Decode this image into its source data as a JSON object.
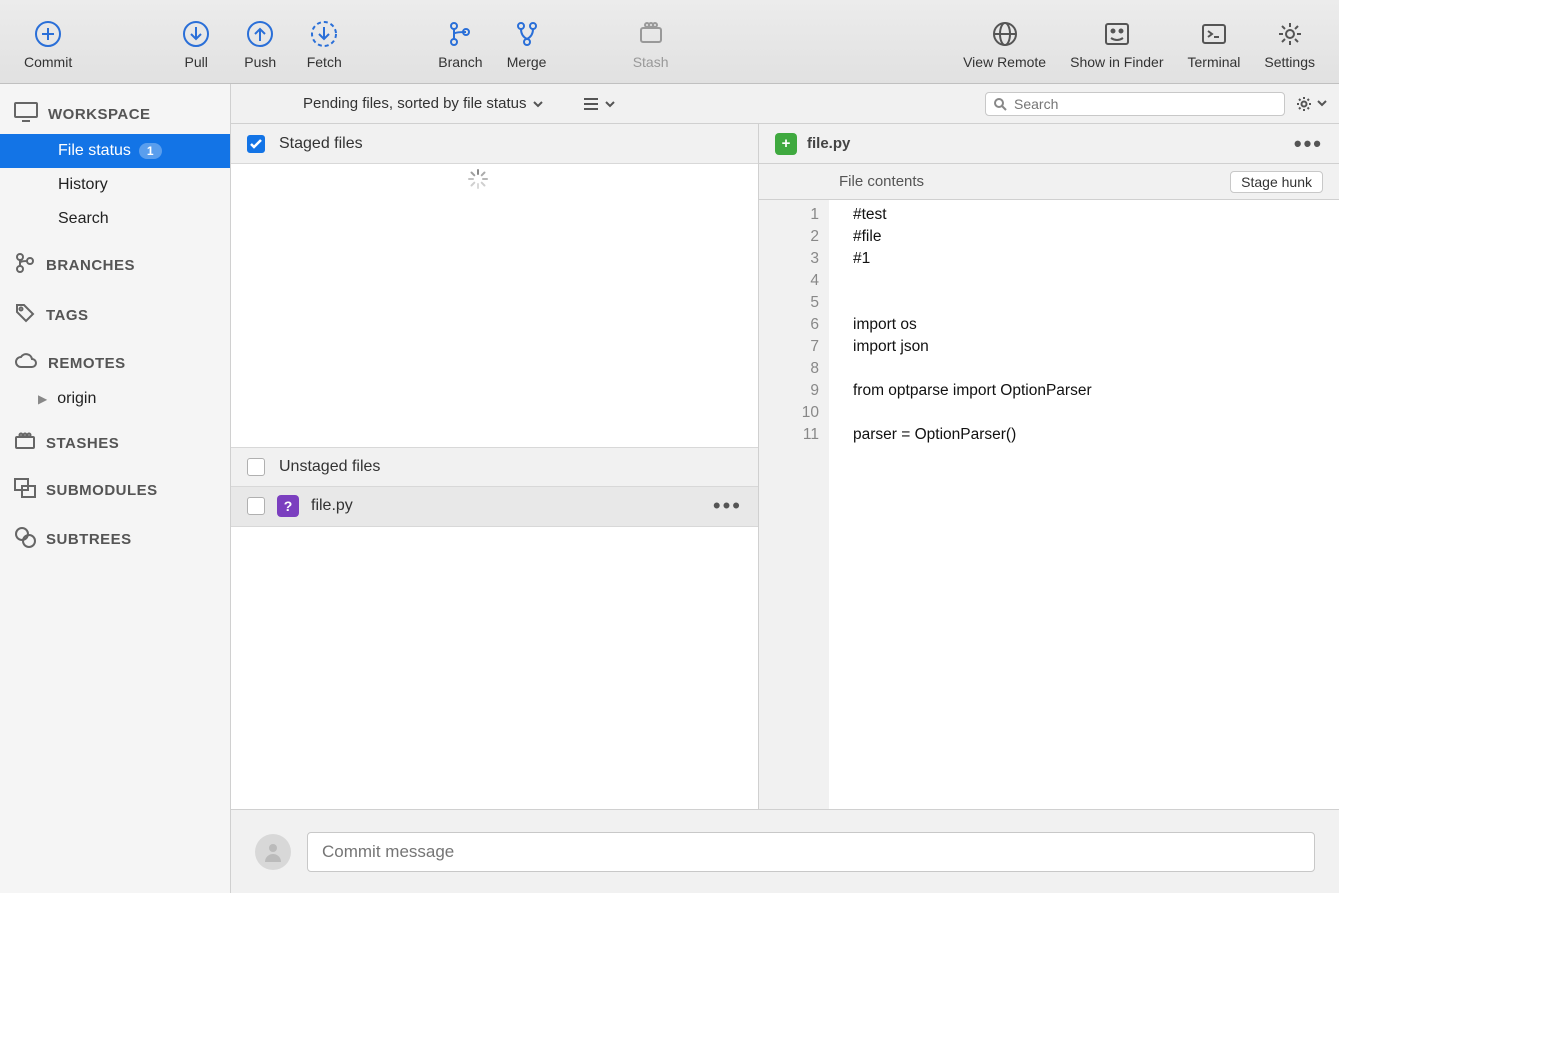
{
  "toolbar": {
    "commit": "Commit",
    "pull": "Pull",
    "push": "Push",
    "fetch": "Fetch",
    "branch": "Branch",
    "merge": "Merge",
    "stash": "Stash",
    "viewRemote": "View Remote",
    "showInFinder": "Show in Finder",
    "terminal": "Terminal",
    "settings": "Settings"
  },
  "sidebar": {
    "workspace": {
      "label": "WORKSPACE",
      "items": [
        "File status",
        "History",
        "Search"
      ],
      "badge": "1"
    },
    "branches": "BRANCHES",
    "tags": "TAGS",
    "remotes": {
      "label": "REMOTES",
      "items": [
        "origin"
      ]
    },
    "stashes": "STASHES",
    "submodules": "SUBMODULES",
    "subtrees": "SUBTREES"
  },
  "filter": {
    "label": "Pending files, sorted by file status",
    "searchPlaceholder": "Search"
  },
  "staged": {
    "label": "Staged files"
  },
  "unstaged": {
    "label": "Unstaged files",
    "file": "file.py"
  },
  "diff": {
    "filename": "file.py",
    "hunkLabel": "File contents",
    "stageHunk": "Stage hunk",
    "lineNumbers": [
      "1",
      "2",
      "3",
      "4",
      "5",
      "6",
      "7",
      "8",
      "9",
      "10",
      "11"
    ],
    "lines": [
      "#test",
      "#file",
      "#1",
      "",
      "",
      "import os",
      "import json",
      "",
      "from optparse import OptionParser",
      "",
      "parser = OptionParser()"
    ]
  },
  "commit": {
    "placeholder": "Commit message"
  }
}
